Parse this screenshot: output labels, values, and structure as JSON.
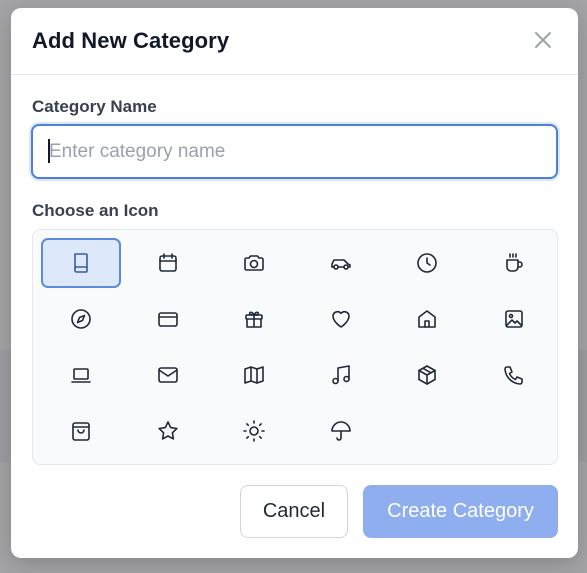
{
  "dialog": {
    "title": "Add New Category",
    "close_icon": "close-icon"
  },
  "name_field": {
    "label": "Category Name",
    "value": "",
    "placeholder": "Enter category name"
  },
  "icon_picker": {
    "label": "Choose an Icon",
    "selected": "book",
    "icons": [
      "book",
      "calendar",
      "camera",
      "car",
      "clock",
      "coffee",
      "compass",
      "credit-card",
      "gift",
      "heart",
      "home",
      "image",
      "laptop",
      "mail",
      "map",
      "music",
      "package",
      "phone",
      "shopping-bag",
      "star",
      "sun",
      "umbrella"
    ]
  },
  "actions": {
    "cancel_label": "Cancel",
    "create_label": "Create Category"
  },
  "colors": {
    "accent": "#4f7fd6",
    "create_button_disabled": "#8eaef0",
    "selected_icon_bg": "#dde8fb"
  }
}
